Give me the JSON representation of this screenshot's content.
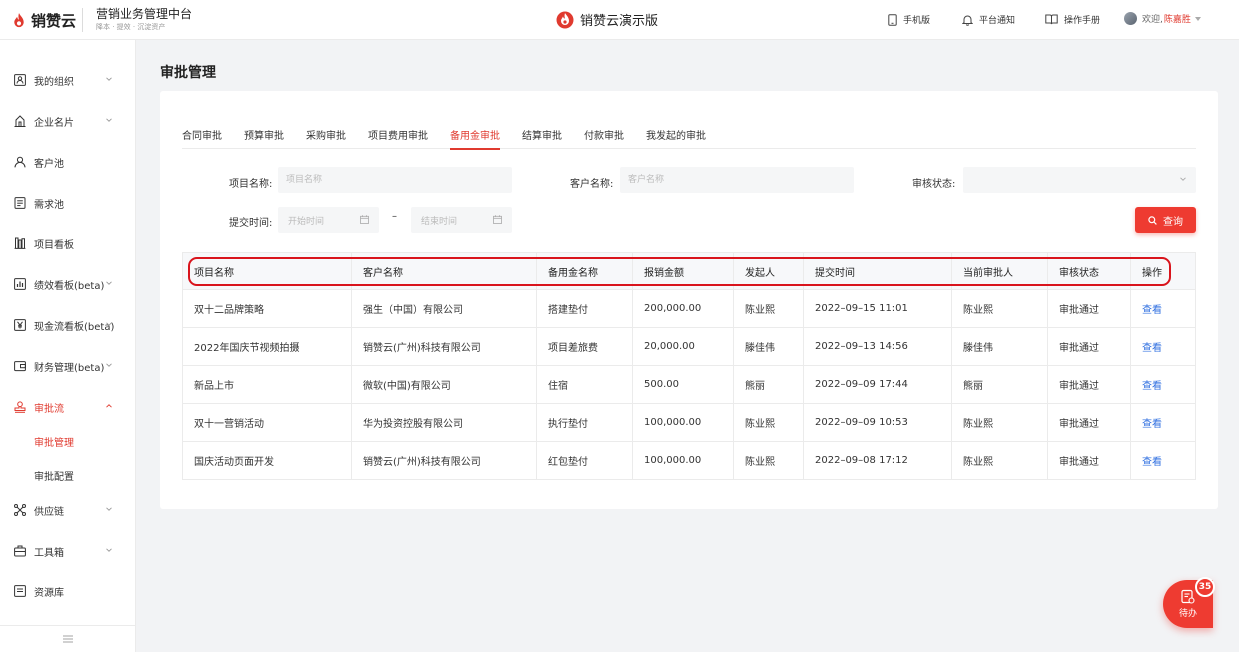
{
  "brand": {
    "name": "销赞云",
    "color": "#e03a2f"
  },
  "platform": {
    "name": "营销业务管理中台",
    "subtitle": "降本 · 提效 · 沉淀资产"
  },
  "demo": {
    "label": "销赞云演示版"
  },
  "header_links": [
    {
      "label": "手机版",
      "icon": "mobile-icon"
    },
    {
      "label": "平台通知",
      "icon": "bell-icon"
    },
    {
      "label": "操作手册",
      "icon": "book-icon"
    }
  ],
  "user": {
    "greeting": "欢迎,",
    "name": "陈嘉胜"
  },
  "sidebar": {
    "items": [
      {
        "label": "我的组织",
        "icon": "org-icon",
        "expandable": true
      },
      {
        "label": "企业名片",
        "icon": "building-icon",
        "expandable": true
      },
      {
        "label": "客户池",
        "icon": "user-icon",
        "expandable": false
      },
      {
        "label": "需求池",
        "icon": "document-icon",
        "expandable": false
      },
      {
        "label": "项目看板",
        "icon": "board-icon",
        "expandable": false
      },
      {
        "label": "绩效看板(beta)",
        "icon": "chart-icon",
        "expandable": true
      },
      {
        "label": "现金流看板(beta)",
        "icon": "yen-icon",
        "expandable": true
      },
      {
        "label": "财务管理(beta)",
        "icon": "wallet-icon",
        "expandable": true
      },
      {
        "label": "审批流",
        "icon": "stamp-icon",
        "expandable": true,
        "expanded": true,
        "active": true
      },
      {
        "label": "供应链",
        "icon": "network-icon",
        "expandable": true
      },
      {
        "label": "工具箱",
        "icon": "toolbox-icon",
        "expandable": true
      },
      {
        "label": "资源库",
        "icon": "folder-icon",
        "expandable": false
      }
    ],
    "sub_items": [
      {
        "label": "审批管理",
        "active": true
      },
      {
        "label": "审批配置",
        "active": false
      }
    ]
  },
  "page": {
    "title": "审批管理"
  },
  "tabs": [
    {
      "label": "合同审批"
    },
    {
      "label": "预算审批"
    },
    {
      "label": "采购审批"
    },
    {
      "label": "项目费用审批"
    },
    {
      "label": "备用金审批",
      "active": true
    },
    {
      "label": "结算审批"
    },
    {
      "label": "付款审批"
    },
    {
      "label": "我发起的审批"
    }
  ],
  "filters": {
    "project_name": {
      "label": "项目名称:",
      "placeholder": "项目名称"
    },
    "customer_name": {
      "label": "客户名称:",
      "placeholder": "客户名称"
    },
    "status": {
      "label": "审核状态:",
      "value": ""
    },
    "submit_time": {
      "label": "提交时间:",
      "start_placeholder": "开始时间",
      "end_placeholder": "结束时间",
      "separator": "–"
    },
    "query_label": "查询"
  },
  "table": {
    "headers": [
      "项目名称",
      "客户名称",
      "备用金名称",
      "报销金额",
      "发起人",
      "提交时间",
      "当前审批人",
      "审核状态",
      "操作"
    ],
    "rows": [
      [
        "双十二品牌策略",
        "强生（中国）有限公司",
        "搭建垫付",
        "200,000.00",
        "陈业熙",
        "2022–09–15 11:01",
        "陈业熙",
        "审批通过",
        "查看"
      ],
      [
        "2022年国庆节视频拍摄",
        "销赞云(广州)科技有限公司",
        "项目差旅费",
        "20,000.00",
        "滕佳伟",
        "2022–09–13 14:56",
        "滕佳伟",
        "审批通过",
        "查看"
      ],
      [
        "新品上市",
        "微软(中国)有限公司",
        "住宿",
        "500.00",
        "熊丽",
        "2022–09–09 17:44",
        "熊丽",
        "审批通过",
        "查看"
      ],
      [
        "双十一营销活动",
        "华为投资控股有限公司",
        "执行垫付",
        "100,000.00",
        "陈业熙",
        "2022–09–09 10:53",
        "陈业熙",
        "审批通过",
        "查看"
      ],
      [
        "国庆活动页面开发",
        "销赞云(广州)科技有限公司",
        "红包垫付",
        "100,000.00",
        "陈业熙",
        "2022–09–08 17:12",
        "陈业熙",
        "审批通过",
        "查看"
      ]
    ]
  },
  "todo": {
    "label": "待办",
    "count": "35"
  }
}
